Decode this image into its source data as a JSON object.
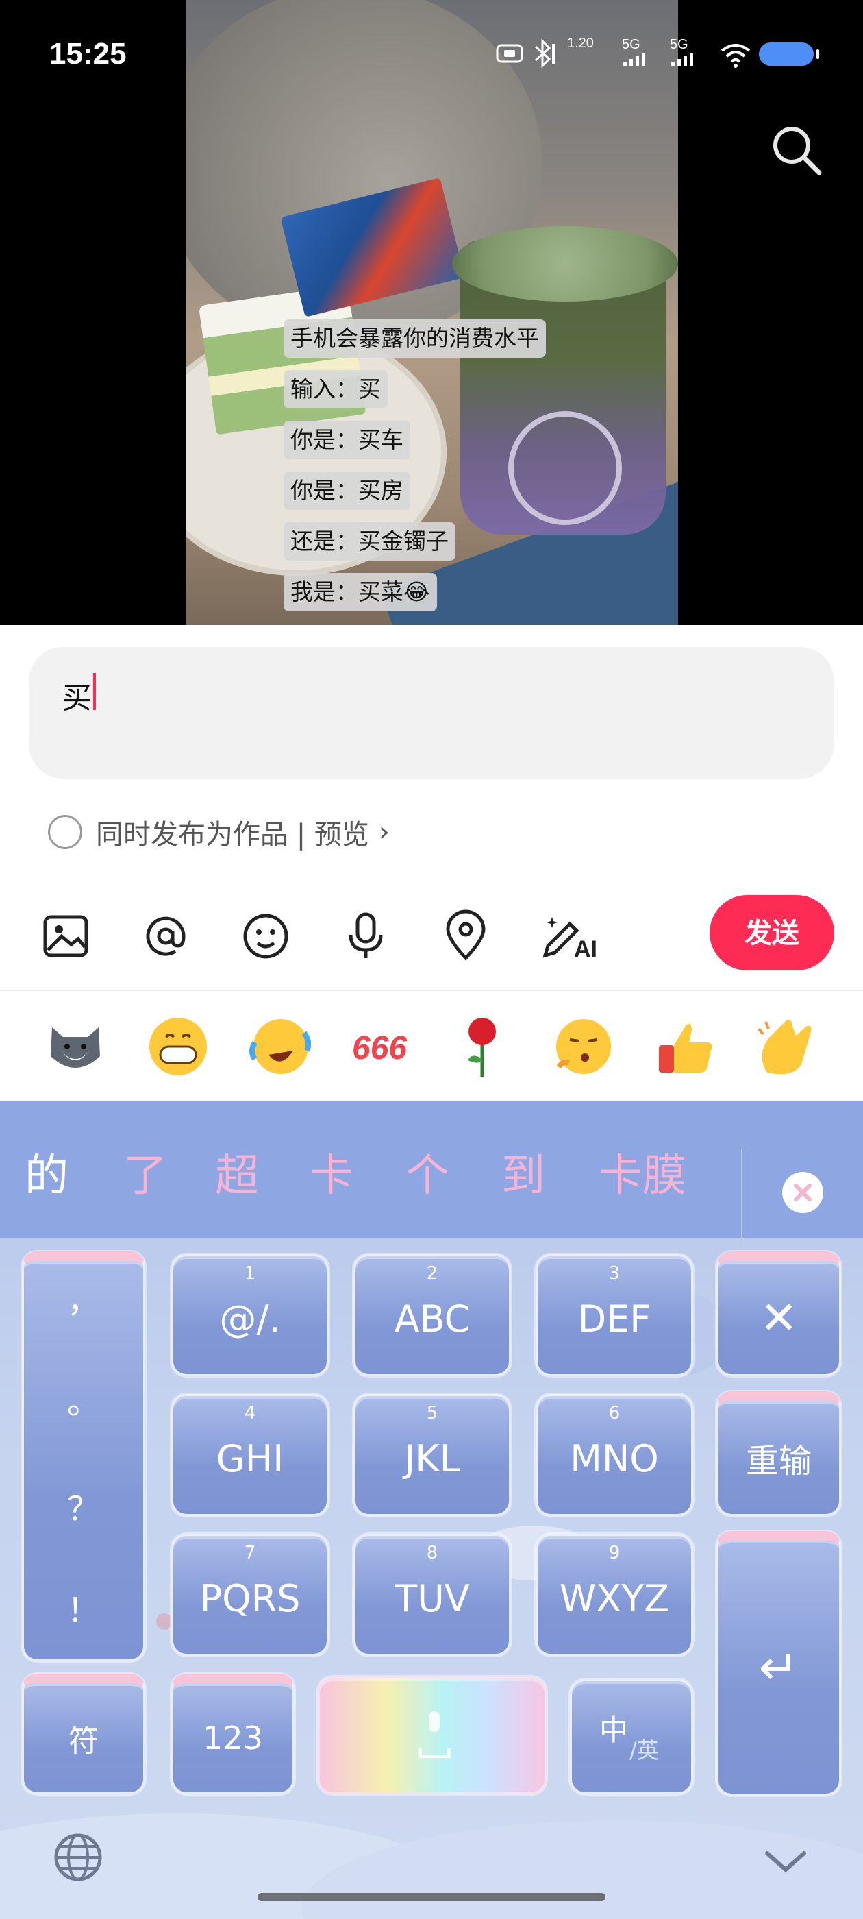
{
  "status_bar": {
    "time": "15:25",
    "speed": "1.20",
    "network1": "5G",
    "network2": "5G"
  },
  "video": {
    "captions": [
      "手机会暴露你的消费水平",
      "输入：买",
      "你是：买车",
      "你是：买房",
      "还是：买金镯子",
      "我是：买菜😂"
    ]
  },
  "comment": {
    "input_value": "买",
    "publish_label": "同时发布为作品 | 预览",
    "publish_arrow": "›",
    "send_label": "发送",
    "toolbar_icons": [
      "image-icon",
      "at-icon",
      "emoji-icon",
      "microphone-icon",
      "location-icon",
      "ai-pen-icon"
    ]
  },
  "emoji_row": [
    "husky-emoji",
    "grin-emoji",
    "laugh-cry-emoji",
    "666-emoji",
    "rose-emoji",
    "whistle-emoji",
    "thumbs-up-emoji",
    "clap-emoji"
  ],
  "keyboard": {
    "candidates": [
      "的",
      "了",
      "超",
      "卡",
      "个",
      "到",
      "卡膜"
    ],
    "punct": [
      "，",
      "。",
      "？",
      "！"
    ],
    "keys": [
      {
        "num": "1",
        "label": "@/."
      },
      {
        "num": "2",
        "label": "ABC"
      },
      {
        "num": "3",
        "label": "DEF"
      },
      {
        "num": "4",
        "label": "GHI"
      },
      {
        "num": "5",
        "label": "JKL"
      },
      {
        "num": "6",
        "label": "MNO"
      },
      {
        "num": "7",
        "label": "PQRS"
      },
      {
        "num": "8",
        "label": "TUV"
      },
      {
        "num": "9",
        "label": "WXYZ"
      }
    ],
    "delete_symbol": "✕",
    "retype_label": "重输",
    "enter_symbol": "↵",
    "symbol_label": "符",
    "numeric_label": "123",
    "lang_main": "中",
    "lang_sub": "/英"
  },
  "colors": {
    "accent": "#fe2c55",
    "candidate_bar": "#8ea6e2",
    "candidate_text": "#f7b3d3",
    "key_fill": "#8298d6"
  }
}
